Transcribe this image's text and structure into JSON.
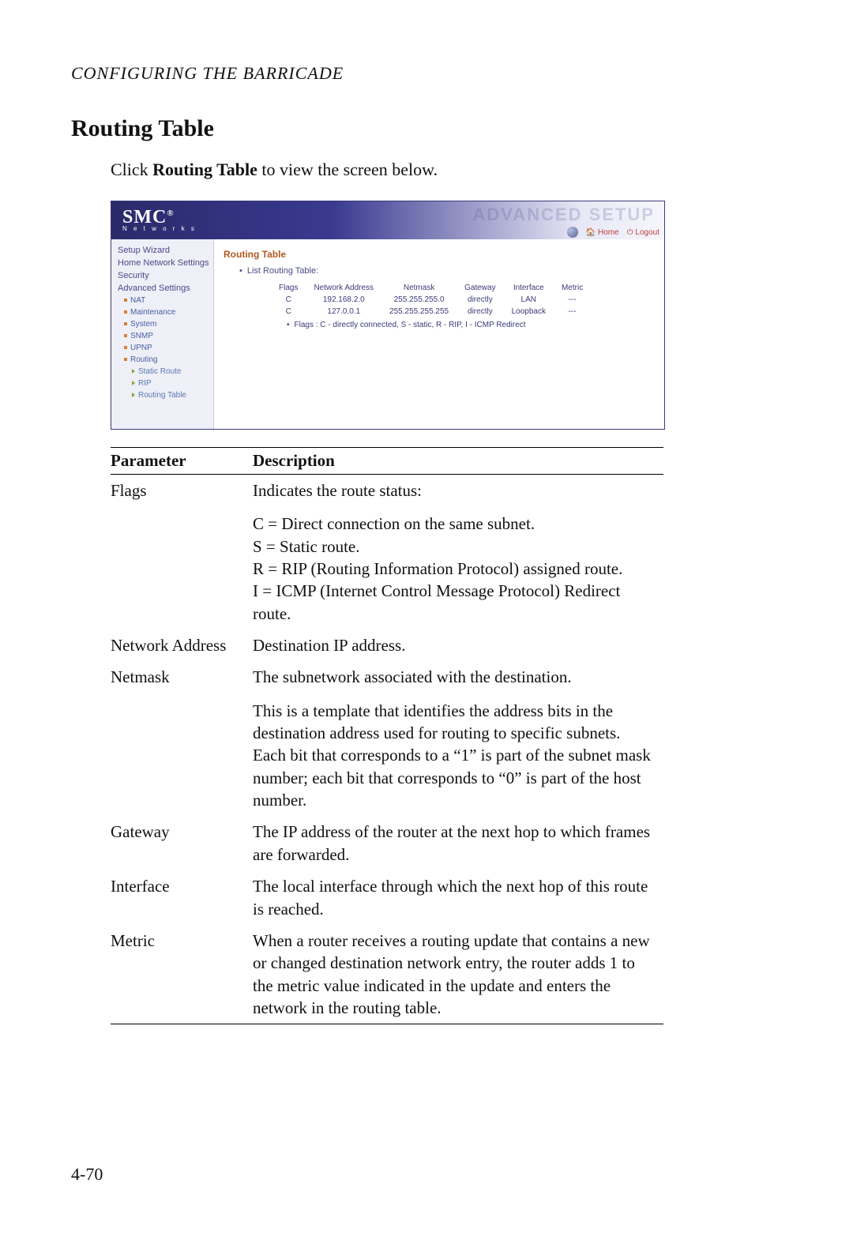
{
  "running_head": "CONFIGURING THE BARRICADE",
  "section_title": "Routing Table",
  "intro_pre": "Click ",
  "intro_bold": "Routing Table",
  "intro_post": " to view the screen below.",
  "page_number": "4-70",
  "shot": {
    "logo_main": "SMC",
    "logo_reg": "®",
    "logo_sub": "N e t w o r k s",
    "banner_title": "ADVANCED SETUP",
    "toolbar": {
      "home": "Home",
      "logout": "Logout"
    },
    "sidebar": {
      "setup_wizard": "Setup Wizard",
      "home_network": "Home Network Settings",
      "security": "Security",
      "advanced": "Advanced Settings",
      "nat": "NAT",
      "maintenance": "Maintenance",
      "system": "System",
      "snmp": "SNMP",
      "upnp": "UPNP",
      "routing": "Routing",
      "static_route": "Static Route",
      "rip": "RIP",
      "routing_table": "Routing Table"
    },
    "content_title": "Routing Table",
    "bullet_label": "List Routing Table:",
    "columns": {
      "flags": "Flags",
      "network_address": "Network Address",
      "netmask": "Netmask",
      "gateway": "Gateway",
      "interface": "Interface",
      "metric": "Metric"
    },
    "rows": [
      {
        "flags": "C",
        "network_address": "192.168.2.0",
        "netmask": "255.255.255.0",
        "gateway": "directly",
        "interface": "LAN",
        "metric": "---"
      },
      {
        "flags": "C",
        "network_address": "127.0.0.1",
        "netmask": "255.255.255.255",
        "gateway": "directly",
        "interface": "Loopback",
        "metric": "---"
      }
    ],
    "legend": "Flags :  C - directly connected, S - static, R - RIP, I - ICMP Redirect"
  },
  "params": {
    "header_param": "Parameter",
    "header_desc": "Description",
    "rows": {
      "flags": {
        "param": "Flags",
        "lead": "Indicates the route status:",
        "lines": [
          "C = Direct connection on the same subnet.",
          "S = Static route.",
          "R = RIP (Routing Information Protocol) assigned route.",
          "I = ICMP (Internet Control Message Protocol) Redirect route."
        ]
      },
      "network_address": {
        "param": "Network Address",
        "desc": "Destination IP address."
      },
      "netmask": {
        "param": "Netmask",
        "lead": "The subnetwork associated with the destination.",
        "extra": "This is a template that identifies the address bits in the destination address used for routing to specific subnets. Each bit that corresponds to a “1” is part of the subnet mask number; each bit that corresponds to “0” is part of the host number."
      },
      "gateway": {
        "param": "Gateway",
        "desc": "The IP address of the router at the next hop to which frames are forwarded."
      },
      "interface": {
        "param": "Interface",
        "desc": "The local interface through which the next hop of this route is reached."
      },
      "metric": {
        "param": "Metric",
        "desc": "When a router receives a routing update that contains a new or changed destination network entry, the router adds 1 to the metric value indicated in the update and enters the network in the routing table."
      }
    }
  }
}
